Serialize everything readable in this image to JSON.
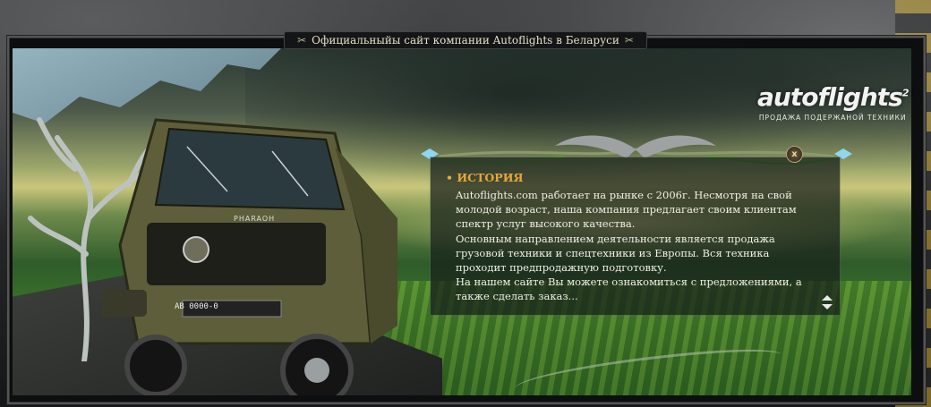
{
  "site": {
    "title": "Официальныйы сайт компании Autoflights в Беларуси"
  },
  "logo": {
    "brand": "autoflights",
    "superscript": "2",
    "tagline": "ПРОДАЖА ПОДЕРЖАНОЙ ТЕХНИКИ"
  },
  "panel": {
    "heading": "ИСТОРИЯ",
    "paragraphs": [
      "Autoflights.com работает на рынке с 2006г. Несмотря на свой молодой возраст, наша компания предлагает своим клиентам спектр услуг высокого качества.",
      "Основным направлением деятельности является продажа грузовой техники и спецтехники из Европы. Вся техника проходит предпродажную подготовку.",
      "На нашем сайте Вы можете ознакомиться с предложениями, а также сделать заказ..."
    ],
    "close_label": "x"
  },
  "truck": {
    "model_badge": "PHARAOH",
    "plate": "АВ 0000-0"
  },
  "colors": {
    "heading_accent": "#e8a73a",
    "panel_text": "#f0efe6",
    "frame_dark": "#0d0e0f"
  }
}
